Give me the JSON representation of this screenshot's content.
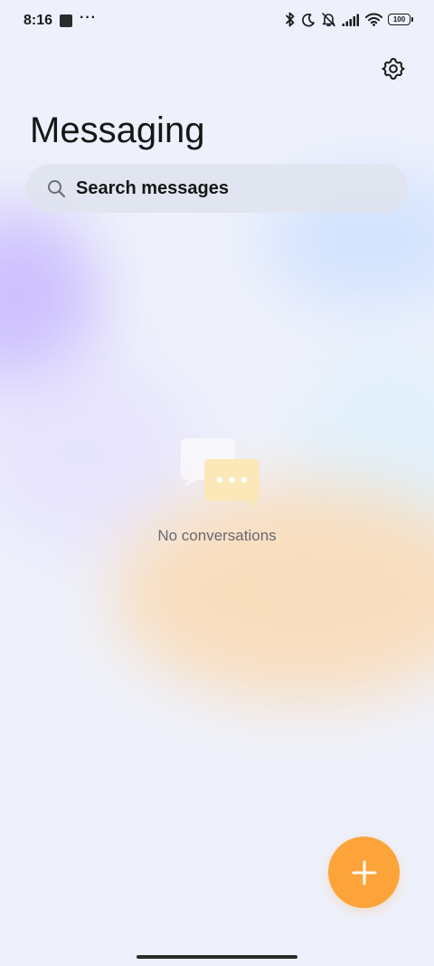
{
  "status_bar": {
    "time": "8:16",
    "more": "···",
    "battery": "100",
    "icons": [
      "bluetooth-icon",
      "moon-icon",
      "bell-off-icon",
      "signal-icon",
      "wifi-icon",
      "battery-icon"
    ]
  },
  "header": {
    "title": "Messaging",
    "settings_icon": "gear-icon"
  },
  "search": {
    "placeholder": "Search messages",
    "icon": "search-icon"
  },
  "empty_state": {
    "text": "No conversations",
    "icon": "chat-bubbles-icon"
  },
  "fab": {
    "icon": "plus-icon"
  },
  "colors": {
    "accent": "#fca43a",
    "background": "#eef1fb",
    "search_background": "#dfe4ef",
    "empty_text": "#666a72"
  }
}
